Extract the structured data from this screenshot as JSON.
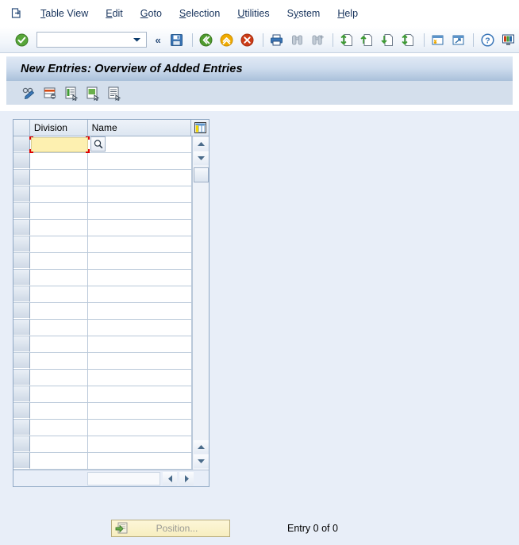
{
  "menu": {
    "system_icon": "sap-session-icon",
    "items": [
      {
        "label": "Table View",
        "accel": "T"
      },
      {
        "label": "Edit",
        "accel": "E"
      },
      {
        "label": "Goto",
        "accel": "G"
      },
      {
        "label": "Selection",
        "accel": "S"
      },
      {
        "label": "Utilities",
        "accel": "U"
      },
      {
        "label": "System",
        "accel": "y"
      },
      {
        "label": "Help",
        "accel": "H"
      }
    ]
  },
  "toolbar": {
    "enter_icon": "green-check-enter-icon",
    "command_value": "",
    "command_placeholder": "",
    "dropdown_icon": "chevron-down-icon",
    "collapse_icon": "double-chevron-left-icon",
    "save_icon": "save-disk-icon",
    "back_icon": "green-back-icon",
    "exit_icon": "yellow-exit-up-icon",
    "cancel_icon": "red-cancel-icon",
    "print_icon": "printer-icon",
    "find_icon": "binoculars-find-icon",
    "find_next_icon": "binoculars-find-next-icon",
    "first_page_icon": "first-page-icon",
    "previous_page_icon": "previous-page-icon",
    "next_page_icon": "next-page-icon",
    "last_page_icon": "last-page-icon",
    "new_session_icon": "create-session-icon",
    "shortcut_icon": "create-shortcut-icon",
    "help_icon": "help-question-icon",
    "layout_icon": "customize-layout-icon"
  },
  "title": {
    "text": "New Entries: Overview of Added Entries"
  },
  "app_toolbar": {
    "items": [
      {
        "name": "display-change-icon",
        "label": "Display/Change"
      },
      {
        "name": "variable-list-icon",
        "label": "Variable List"
      },
      {
        "name": "select-block-icon",
        "label": "Select Block"
      },
      {
        "name": "select-all-icon",
        "label": "Select All"
      },
      {
        "name": "deselect-all-icon",
        "label": "Deselect All"
      }
    ]
  },
  "table": {
    "settings_icon": "table-settings-icon",
    "columns": [
      {
        "key": "division",
        "label": "Division"
      },
      {
        "key": "name",
        "label": "Name"
      }
    ],
    "focused_cell": {
      "column": "division",
      "value": "",
      "f4_icon": "search-magnifier-icon"
    },
    "rows": [
      {
        "division": "",
        "name": ""
      },
      {
        "division": "",
        "name": ""
      },
      {
        "division": "",
        "name": ""
      },
      {
        "division": "",
        "name": ""
      },
      {
        "division": "",
        "name": ""
      },
      {
        "division": "",
        "name": ""
      },
      {
        "division": "",
        "name": ""
      },
      {
        "division": "",
        "name": ""
      },
      {
        "division": "",
        "name": ""
      },
      {
        "division": "",
        "name": ""
      },
      {
        "division": "",
        "name": ""
      },
      {
        "division": "",
        "name": ""
      },
      {
        "division": "",
        "name": ""
      },
      {
        "division": "",
        "name": ""
      },
      {
        "division": "",
        "name": ""
      },
      {
        "division": "",
        "name": ""
      },
      {
        "division": "",
        "name": ""
      },
      {
        "division": "",
        "name": ""
      },
      {
        "division": "",
        "name": ""
      }
    ],
    "vscroll": {
      "up_icon": "scroll-up-icon",
      "down_icon": "scroll-down-icon",
      "bottom_up_icon": "scroll-up-icon",
      "bottom_down_icon": "scroll-down-icon"
    },
    "hscroll": {
      "left_icon": "scroll-left-icon",
      "right_icon": "scroll-right-icon"
    }
  },
  "footer": {
    "position_button": {
      "label": "Position...",
      "icon": "position-goto-icon",
      "enabled": false
    },
    "entry_status": "Entry 0 of 0"
  },
  "colors": {
    "focus_border": "#e00000",
    "active_cell": "#fdf0b0",
    "canvas": "#e8eef8",
    "title_gradient_end": "#a9c0da",
    "button_yellow": "#f7eec0"
  }
}
